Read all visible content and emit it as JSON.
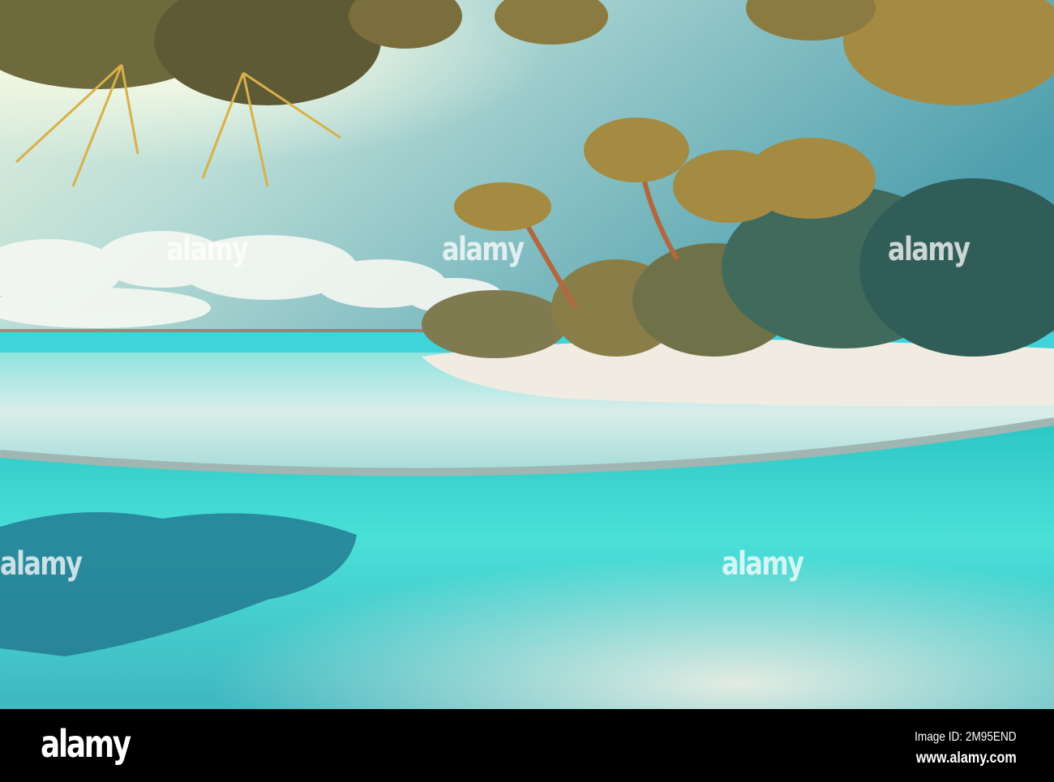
{
  "scene": {
    "description_colors": {
      "sky_top": "#4c9fb0",
      "sky_glow": "#f4f8e0",
      "sea": "#3fd6d8",
      "underwater": "#35d6cf",
      "sand": "#f1ece2",
      "palm": "#8a7a3a",
      "shadow": "#1f6f8a"
    }
  },
  "watermark": {
    "text": "alamy"
  },
  "footer": {
    "logo": "alamy",
    "image_id": "Image ID: 2M95END",
    "website": "www.alamy.com"
  }
}
